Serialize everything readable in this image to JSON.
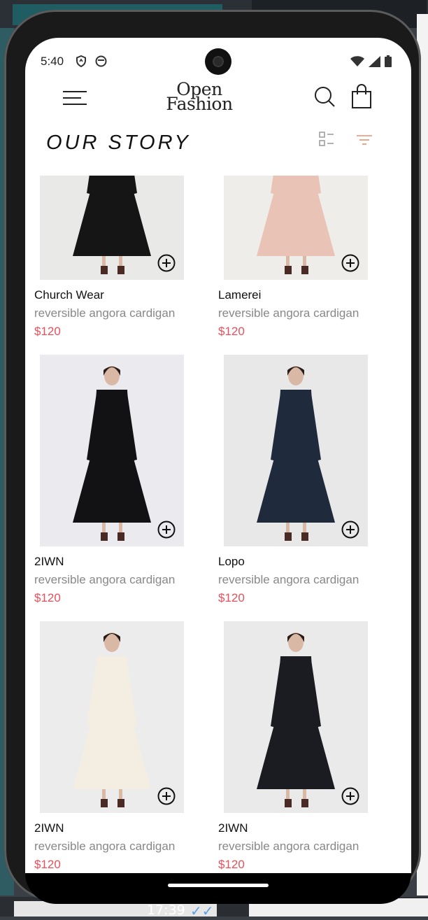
{
  "status_bar": {
    "time": "5:40"
  },
  "header": {
    "logo_line1": "Open",
    "logo_line2": "Fashion"
  },
  "page": {
    "title": "OUR STORY"
  },
  "products": [
    {
      "brand": "Church Wear",
      "description": "reversible angora cardigan",
      "price": "$120",
      "image_tone": "#e9e9e7",
      "garment_color": "#151515"
    },
    {
      "brand": "Lamerei",
      "description": "reversible angora cardigan",
      "price": "$120",
      "image_tone": "#efede9",
      "garment_color": "#e9c3b5"
    },
    {
      "brand": "2IWN",
      "description": "reversible angora cardigan",
      "price": "$120",
      "image_tone": "#ebeaee",
      "garment_color": "#121214"
    },
    {
      "brand": "Lopo",
      "description": "reversible angora cardigan",
      "price": "$120",
      "image_tone": "#e8e8e8",
      "garment_color": "#1f2a3d"
    },
    {
      "brand": "2IWN",
      "description": "reversible angora cardigan",
      "price": "$120",
      "image_tone": "#ececec",
      "garment_color": "#f3ede2"
    },
    {
      "brand": "2IWN",
      "description": "reversible angora cardigan",
      "price": "$120",
      "image_tone": "#eaeaea",
      "garment_color": "#1a1c22"
    }
  ],
  "taskbar": {
    "time": "17:39"
  },
  "colors": {
    "accent": "#e8505b",
    "filter_icon": "#e89070"
  },
  "icons": [
    "menu-icon",
    "search-icon",
    "shopping-bag-icon",
    "list-view-icon",
    "filter-icon",
    "add-circle-icon"
  ]
}
